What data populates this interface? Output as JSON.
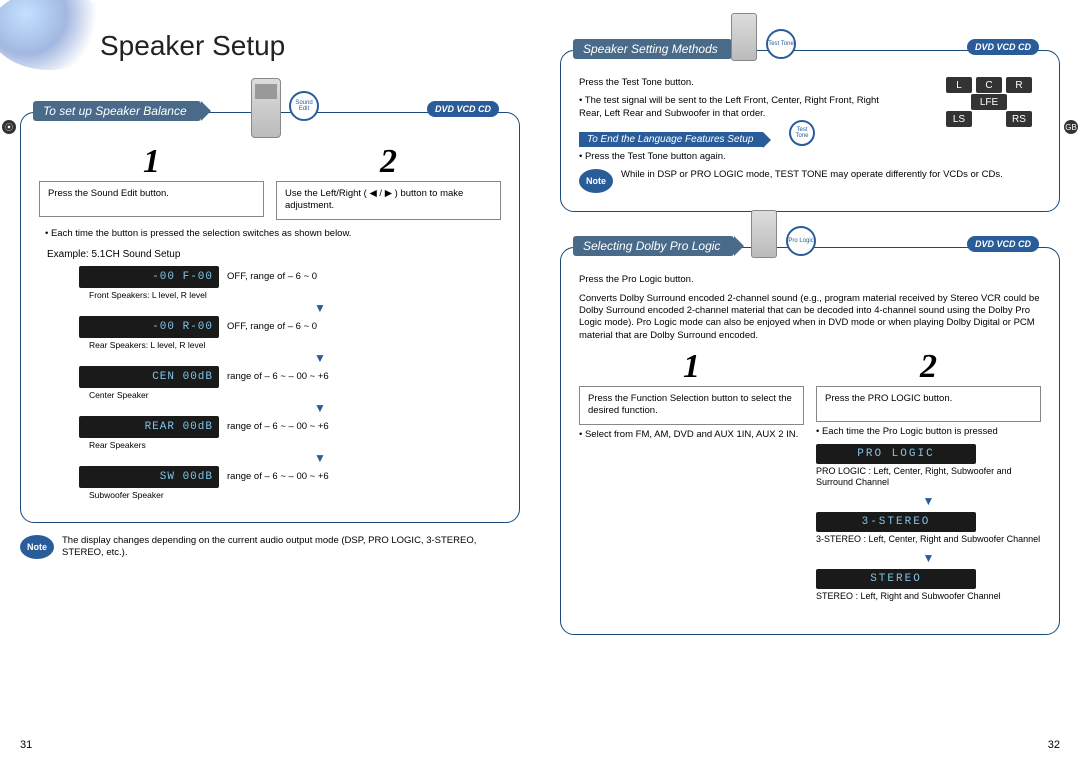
{
  "main_title": "Speaker Setup",
  "disc_badge": "DVD VCD CD",
  "left": {
    "section_title": "To set up Speaker Balance",
    "btn_label": "Sound Edit",
    "step1_num": "1",
    "step1_text": "Press the Sound Edit  button.",
    "step2_num": "2",
    "step2_text": "Use the Left/Right  ( ◀ / ▶ ) button to make adjustment.",
    "bullet1": "• Each time the button is pressed the selection switches as shown below.",
    "example_label": "Example: 5.1CH Sound Setup",
    "rows": [
      {
        "vfd": "-00 F-00",
        "caption": "Front Speakers: L level, R level",
        "note": "OFF, range of – 6 ~ 0"
      },
      {
        "vfd": "-00 R-00",
        "caption": "Rear Speakers: L level, R level",
        "note": "OFF, range of – 6 ~ 0"
      },
      {
        "vfd": "CEN  00dB",
        "caption": "Center Speaker",
        "note": "range of – 6 ~ – 00 ~ +6"
      },
      {
        "vfd": "REAR 00dB",
        "caption": "Rear Speakers",
        "note": "range of – 6 ~ – 00 ~ +6"
      },
      {
        "vfd": "SW   00dB",
        "caption": "Subwoofer Speaker",
        "note": "range of – 6 ~ – 00 ~ +6"
      }
    ],
    "note_label": "Note",
    "note_text": "The display changes depending on the current audio output mode (DSP, PRO LOGIC, 3-STEREO, STEREO, etc.).",
    "page_num": "31"
  },
  "right": {
    "section1": {
      "title": "Speaker Setting Methods",
      "btn_label": "Test Tone",
      "press": "Press the Test Tone button.",
      "bullet": "• The test signal will be sent to the Left Front, Center, Right Front, Right Rear, Left Rear and Subwoofer in that order.",
      "sub_title": "To End the Language Features Setup",
      "sub_bullet": "• Press the Test Tone  button again.",
      "btn_label2": "Test Tone",
      "speakers": {
        "L": "L",
        "C": "C",
        "R": "R",
        "LFE": "LFE",
        "LS": "LS",
        "RS": "RS"
      },
      "note_label": "Note",
      "note_text": "While in DSP or PRO LOGIC mode, TEST TONE may operate differently for VCDs or CDs."
    },
    "section2": {
      "title": "Selecting Dolby Pro Logic",
      "btn_label": "Pro Logic",
      "press": "Press the Pro Logic button.",
      "paragraph": "Converts Dolby Surround encoded 2-channel sound (e.g., program material received by Stereo VCR could be Dolby Surround encoded 2-channel material that can be decoded into 4-channel sound using the Dolby Pro Logic mode). Pro Logic mode can also be enjoyed when in DVD mode or when playing Dolby Digital or PCM material that are Dolby Surround encoded.",
      "step1_num": "1",
      "step1_text": "Press the Function Selection button to select the desired function.",
      "step1_bullet": "• Select from FM, AM, DVD and AUX 1IN, AUX 2 IN.",
      "step2_num": "2",
      "step2_text": "Press the PRO LOGIC button.",
      "step2_bullet": "• Each time the Pro Logic button is pressed",
      "modes": [
        {
          "vfd": "PRO LOGIC",
          "desc": "PRO LOGIC : Left, Center, Right, Subwoofer and Surround Channel"
        },
        {
          "vfd": "3-STEREO",
          "desc": "3-STEREO : Left, Center, Right and Subwoofer Channel"
        },
        {
          "vfd": "STEREO",
          "desc": "STEREO : Left, Right and Subwoofer Channel"
        }
      ]
    },
    "page_num": "32"
  }
}
